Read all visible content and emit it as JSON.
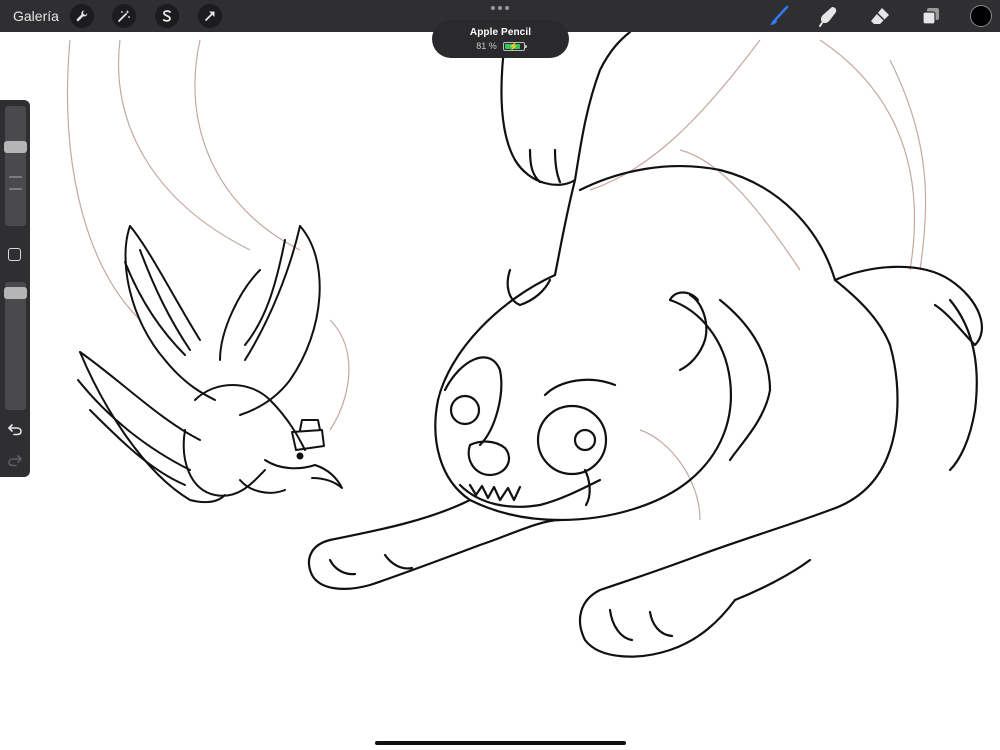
{
  "topbar": {
    "gallery_label": "Galería",
    "left_tools": [
      {
        "name": "actions",
        "icon": "wrench-icon"
      },
      {
        "name": "adjustments",
        "icon": "magic-wand-icon"
      },
      {
        "name": "selection",
        "icon": "selection-s-icon"
      },
      {
        "name": "transform",
        "icon": "arrow-cursor-icon"
      }
    ],
    "right_tools": [
      {
        "name": "brush",
        "icon": "brush-icon",
        "active": true
      },
      {
        "name": "smudge",
        "icon": "smudge-finger-icon"
      },
      {
        "name": "eraser",
        "icon": "eraser-icon"
      },
      {
        "name": "layers",
        "icon": "layers-icon"
      }
    ],
    "current_color": "#000000",
    "accent_color": "#2f7bf6"
  },
  "pencil_toast": {
    "title": "Apple Pencil",
    "battery_text": "81 %",
    "battery_level": 0.81,
    "charging": true,
    "battery_color": "#34c759"
  },
  "sidebar": {
    "brush_size_level": 0.68,
    "opacity_level": 0.96,
    "modify_icon": "square-icon",
    "undo_icon": "undo-arrow-icon",
    "redo_icon": "redo-arrow-icon"
  },
  "canvas": {
    "background": "#ffffff",
    "line_color": "#111111",
    "sketch_color": "#b89890",
    "subjects": [
      "bird-sketch",
      "big-cat-sketch"
    ]
  }
}
